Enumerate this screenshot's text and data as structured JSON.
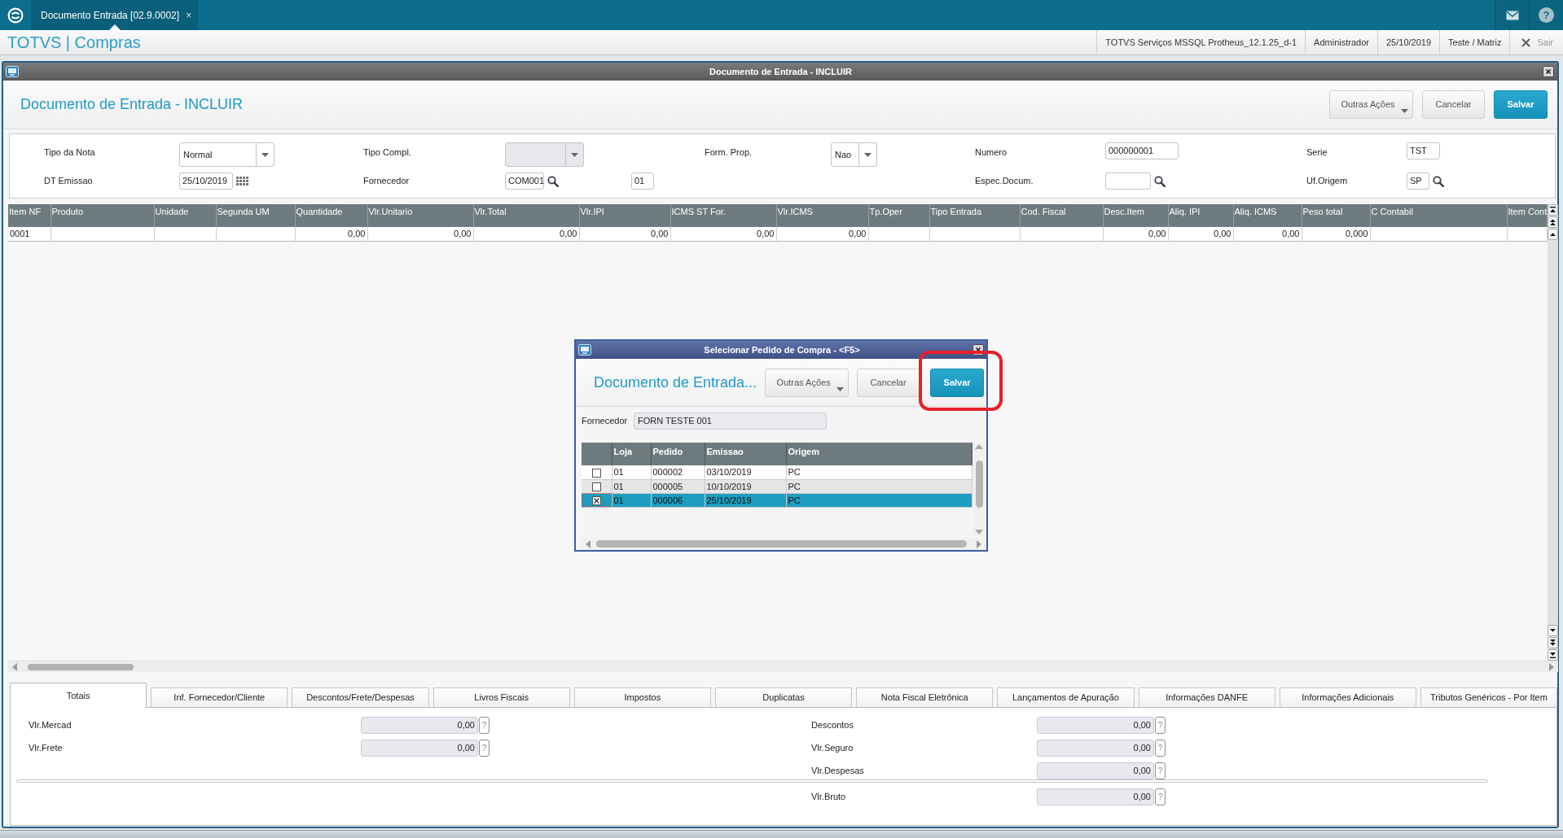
{
  "top_bar": {
    "tabs": [
      {
        "label": "Documento Entrada [02.9.0002]",
        "close_glyph": "×",
        "selected": true
      }
    ],
    "help_glyph": "?"
  },
  "app_header": {
    "title": "TOTVS | Compras",
    "info": [
      "TOTVS Serviços MSSQL Protheus_12.1.25_d-1",
      "Administrador",
      "25/10/2019",
      "Teste / Matriz"
    ],
    "exit_label": "Sair"
  },
  "window": {
    "title": "Documento de Entrada - INCLUIR",
    "heading": "Documento de Entrada - INCLUIR",
    "buttons": [
      {
        "label": "Outras Ações",
        "kind": "menu"
      },
      {
        "label": "Cancelar",
        "kind": "default"
      },
      {
        "label": "Salvar",
        "kind": "primary"
      }
    ]
  },
  "form": {
    "columns": [
      [
        {
          "label": "Tipo da Nota",
          "kind": "select",
          "value": "Normal",
          "disabled": false
        },
        {
          "label": "DT Emissao",
          "kind": "date",
          "value": "25/10/2019"
        }
      ],
      [
        {
          "label": "Tipo Compl.",
          "kind": "select",
          "disabled": true
        },
        {
          "label": "Fornecedor",
          "kind": "lookup",
          "value": "COM001",
          "extra_value": "01"
        }
      ],
      [
        {
          "label": "Form. Prop.",
          "kind": "select",
          "value": "Nao",
          "disabled": false
        }
      ],
      [
        {
          "label": "Numero",
          "kind": "text",
          "value": "000000001"
        },
        {
          "label": "Espec.Docum.",
          "kind": "lookup"
        }
      ],
      [
        {
          "label": "Serie",
          "kind": "text",
          "value": "TST"
        },
        {
          "label": "Uf.Origem",
          "kind": "lookup",
          "value": "SP"
        }
      ]
    ]
  },
  "items_grid": {
    "columns": [
      {
        "label": "Item NF",
        "kind": "text"
      },
      {
        "label": "Produto",
        "kind": "text"
      },
      {
        "label": "Unidade",
        "kind": "text"
      },
      {
        "label": "Segunda UM",
        "kind": "text"
      },
      {
        "label": "Quantidade",
        "kind": "number"
      },
      {
        "label": "Vlr.Unitario",
        "kind": "number"
      },
      {
        "label": "Vlr.Total",
        "kind": "number"
      },
      {
        "label": "Vlr.IPI",
        "kind": "number"
      },
      {
        "label": "ICMS ST For.",
        "kind": "number"
      },
      {
        "label": "Vlr.ICMS",
        "kind": "number"
      },
      {
        "label": "Tp.Oper",
        "kind": "text"
      },
      {
        "label": "Tipo Entrada",
        "kind": "text"
      },
      {
        "label": "Cod. Fiscal",
        "kind": "text"
      },
      {
        "label": "Desc.Item",
        "kind": "number"
      },
      {
        "label": "Aliq. IPI",
        "kind": "number"
      },
      {
        "label": "Aliq. ICMS",
        "kind": "number"
      },
      {
        "label": "Peso total",
        "kind": "number"
      },
      {
        "label": "C Contabil",
        "kind": "text"
      },
      {
        "label": "Item Cont",
        "kind": "text"
      }
    ],
    "rows": [
      [
        "0001",
        null,
        null,
        null,
        "0,00",
        "0,00",
        "0,00",
        "0,00",
        "0,00",
        "0,00",
        null,
        null,
        null,
        "0,00",
        "0,00",
        "0,00",
        "0,000",
        null,
        null
      ]
    ]
  },
  "dialog": {
    "title": "Selecionar Pedido de Compra - <F5>",
    "heading": "Documento de Entrada...",
    "buttons": [
      {
        "label": "Outras Ações",
        "kind": "menu",
        "highlighted": false
      },
      {
        "label": "Cancelar",
        "kind": "default",
        "highlighted": false
      },
      {
        "label": "Salvar",
        "kind": "primary",
        "highlighted": true
      }
    ],
    "supplier": {
      "label": "Fornecedor",
      "value": "FORN TESTE 001"
    },
    "grid": {
      "columns": [
        "Loja",
        "Pedido",
        "Emissao",
        "Origem"
      ],
      "rows": [
        {
          "checked": false,
          "selected": false,
          "cells": [
            "01",
            "000002",
            "03/10/2019",
            "PC"
          ]
        },
        {
          "checked": false,
          "selected": false,
          "cells": [
            "01",
            "000005",
            "10/10/2019",
            "PC"
          ]
        },
        {
          "checked": true,
          "selected": true,
          "cells": [
            "01",
            "000006",
            "25/10/2019",
            "PC"
          ]
        }
      ]
    }
  },
  "bottom_tabs": [
    {
      "label": "Totais",
      "selected": true
    },
    {
      "label": "Inf. Fornecedor/Cliente",
      "selected": false
    },
    {
      "label": "Descontos/Frete/Despesas",
      "selected": false
    },
    {
      "label": "Livros Fiscais",
      "selected": false
    },
    {
      "label": "Impostos",
      "selected": false
    },
    {
      "label": "Duplicatas",
      "selected": false
    },
    {
      "label": "Nota Fiscal Eletrônica",
      "selected": false
    },
    {
      "label": "Lançamentos de Apuração",
      "selected": false
    },
    {
      "label": "Informações DANFE",
      "selected": false
    },
    {
      "label": "Informações Adicionais",
      "selected": false
    },
    {
      "label": "Tributos Genéricos - Por Item",
      "selected": false
    }
  ],
  "totals": {
    "left": [
      {
        "label": "Vlr.Mercad",
        "value": "0,00",
        "help": "?"
      },
      {
        "label": "Vlr.Frete",
        "value": "0,00",
        "help": "?"
      }
    ],
    "right": [
      {
        "label": "Descontos",
        "value": "0,00",
        "help": "?"
      },
      {
        "label": "Vlr.Seguro",
        "value": "0,00",
        "help": "?"
      },
      {
        "label": "Vlr.Despesas",
        "value": "0,00",
        "help": "?"
      }
    ],
    "total": {
      "label": "Vlr.Bruto",
      "value": "0,00",
      "help": "?"
    }
  }
}
